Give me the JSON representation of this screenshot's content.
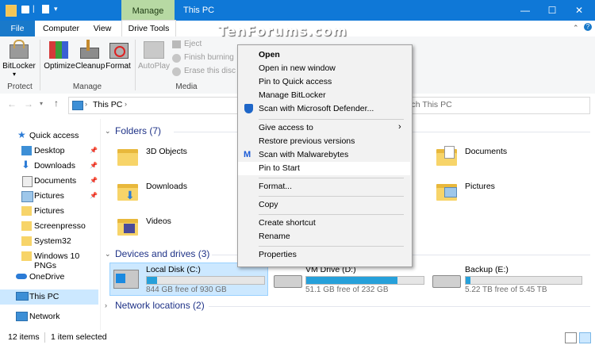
{
  "window": {
    "title": "This PC",
    "context_tab": "Manage",
    "accent": "#0f78d7",
    "context_color": "#b7d9a3",
    "watermark": "TenForums.com"
  },
  "tabs": [
    {
      "label": "File"
    },
    {
      "label": "Computer"
    },
    {
      "label": "View"
    },
    {
      "label": "Drive Tools"
    }
  ],
  "ribbon": {
    "groups": [
      {
        "label": "Protect"
      },
      {
        "label": "Manage"
      },
      {
        "label": "Media"
      }
    ],
    "buttons": {
      "bitlocker": "BitLocker",
      "optimize": "Optimize",
      "cleanup": "Cleanup",
      "format": "Format",
      "autoplay": "AutoPlay",
      "eject": "Eject",
      "finish_burning": "Finish burning",
      "erase_disc": "Erase this disc"
    }
  },
  "address": {
    "path": "This PC",
    "search_placeholder": "rch This PC"
  },
  "nav": {
    "items": [
      {
        "label": "Quick access",
        "icon": "star-icon"
      },
      {
        "label": "Desktop",
        "icon": "desktop-icon",
        "pinned": true
      },
      {
        "label": "Downloads",
        "icon": "download-icon",
        "pinned": true
      },
      {
        "label": "Documents",
        "icon": "documents-icon",
        "pinned": true
      },
      {
        "label": "Pictures",
        "icon": "pictures-icon",
        "pinned": true
      },
      {
        "label": "Pictures",
        "icon": "folder-icon"
      },
      {
        "label": "Screenpresso",
        "icon": "folder-icon"
      },
      {
        "label": "System32",
        "icon": "folder-icon"
      },
      {
        "label": "Windows 10 PNGs",
        "icon": "folder-icon"
      },
      {
        "label": "OneDrive",
        "icon": "cloud-icon"
      },
      {
        "label": "This PC",
        "icon": "computer-icon",
        "selected": true
      },
      {
        "label": "Network",
        "icon": "network-icon"
      }
    ]
  },
  "content": {
    "folders_header": "Folders (7)",
    "devices_header": "Devices and drives (3)",
    "network_header": "Network locations (2)",
    "folders": [
      {
        "label": "3D Objects"
      },
      {
        "label": "Downloads"
      },
      {
        "label": "Videos"
      },
      {
        "label": "Documents"
      },
      {
        "label": "Pictures"
      }
    ],
    "drives": [
      {
        "label": "Local Disk (C:)",
        "free": "844 GB free of 930 GB",
        "used_fraction": 0.09,
        "selected": true
      },
      {
        "label": "VM Drive (D:)",
        "free": "51.1 GB free of 232 GB",
        "used_fraction": 0.78
      },
      {
        "label": "Backup (E:)",
        "free": "5.22 TB free of 5.45 TB",
        "used_fraction": 0.04
      }
    ]
  },
  "status": {
    "count": "12 items",
    "selected": "1 item selected"
  },
  "context_menu": {
    "items": [
      {
        "label": "Open",
        "bold": true
      },
      {
        "label": "Open in new window"
      },
      {
        "label": "Pin to Quick access"
      },
      {
        "label": "Manage BitLocker"
      },
      {
        "label": "Scan with Microsoft Defender...",
        "icon": "defender-shield-icon"
      },
      {
        "label": "Give access to",
        "submenu": true
      },
      {
        "label": "Restore previous versions"
      },
      {
        "label": "Scan with Malwarebytes",
        "icon": "malwarebytes-icon"
      },
      {
        "label": "Pin to Start",
        "highlighted": true
      },
      {
        "label": "Format..."
      },
      {
        "label": "Copy"
      },
      {
        "label": "Create shortcut"
      },
      {
        "label": "Rename"
      },
      {
        "label": "Properties"
      }
    ]
  }
}
